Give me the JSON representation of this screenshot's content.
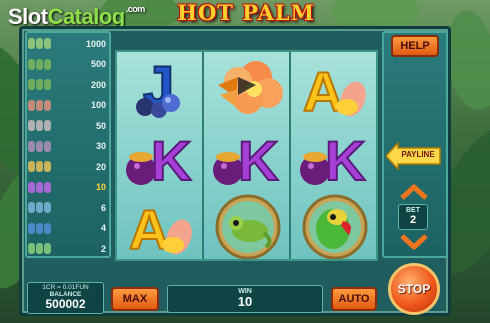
{
  "watermark": {
    "slot": "Slot",
    "catalog": "Catalog",
    "com": ".com"
  },
  "title": "HOT PALM",
  "paytable": [
    {
      "value": "1000",
      "active": false,
      "color": "#8ec47a"
    },
    {
      "value": "500",
      "active": false,
      "color": "#6fae5f"
    },
    {
      "value": "200",
      "active": false,
      "color": "#6fae5f"
    },
    {
      "value": "100",
      "active": false,
      "color": "#c58a7a"
    },
    {
      "value": "50",
      "active": false,
      "color": "#b0b0b0"
    },
    {
      "value": "30",
      "active": false,
      "color": "#9a8ab0"
    },
    {
      "value": "20",
      "active": false,
      "color": "#c9b45a"
    },
    {
      "value": "10",
      "active": true,
      "color": "#a866d6"
    },
    {
      "value": "6",
      "active": false,
      "color": "#6fa8c8"
    },
    {
      "value": "4",
      "active": false,
      "color": "#4b88c8"
    },
    {
      "value": "2",
      "active": false,
      "color": "#7ac07a"
    }
  ],
  "reels": [
    [
      "J",
      "flower",
      "A"
    ],
    [
      "K",
      "K",
      "K"
    ],
    [
      "A",
      "chameleon",
      "parrot"
    ]
  ],
  "symbols": {
    "J": "J",
    "K": "K",
    "A": "A"
  },
  "buttons": {
    "help": "HELP",
    "payline": "PAYLINE",
    "max": "MAX",
    "auto": "AUTO",
    "stop": "STOP"
  },
  "bet": {
    "label": "BET",
    "value": "2"
  },
  "info": {
    "denomination": "1CR = 0.01FUN",
    "balance_label": "BALANCE",
    "balance": "500002"
  },
  "win": {
    "label": "WIN",
    "value": "10"
  },
  "colors": {
    "accent": "#f0581c",
    "frame": "#1f5d5e",
    "gold": "#ffcf2a",
    "purple": "#a63fd6",
    "blue": "#2357c9",
    "yellow": "#ffc21a"
  }
}
